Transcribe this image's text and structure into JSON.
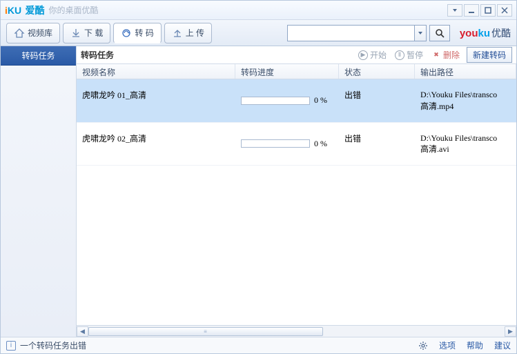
{
  "titlebar": {
    "app": "iKU",
    "app_cn": "爱酷",
    "tagline": "你的桌面优酷"
  },
  "toolbar": {
    "tabs": {
      "library": "视频库",
      "download": "下 载",
      "transcode": "转 码",
      "upload": "上 传"
    },
    "search_placeholder": "",
    "brand_cn": "优酷"
  },
  "sidebar": {
    "items": [
      "转码任务"
    ]
  },
  "subheader": {
    "title": "转码任务",
    "start": "开始",
    "pause": "暂停",
    "delete": "删除",
    "new": "新建转码"
  },
  "columns": {
    "name": "视频名称",
    "progress": "转码进度",
    "status": "状态",
    "output": "输出路径"
  },
  "rows": [
    {
      "name": "虎啸龙吟 01_高清",
      "progress_pct": "0 %",
      "status": "出错",
      "output_path": "D:\\Youku Files\\transco",
      "output_file": "高清.mp4",
      "selected": true
    },
    {
      "name": "虎啸龙吟 02_高清",
      "progress_pct": "0 %",
      "status": "出错",
      "output_path": "D:\\Youku Files\\transco",
      "output_file": "高清.avi",
      "selected": false
    }
  ],
  "statusbar": {
    "message": "一个转码任务出错",
    "options": "选项",
    "help": "帮助",
    "feedback": "建议"
  }
}
